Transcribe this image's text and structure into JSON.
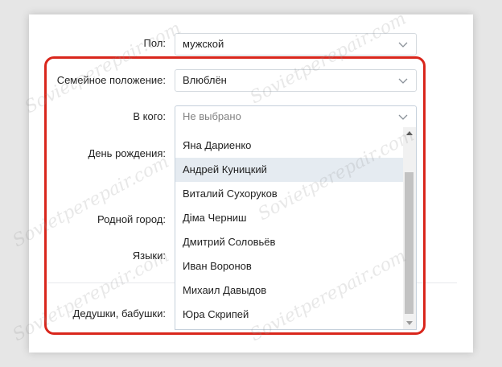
{
  "form": {
    "gender": {
      "label": "Пол:",
      "value": "мужской"
    },
    "marital": {
      "label": "Семейное положение:",
      "value": "Влюблён"
    },
    "partner": {
      "label": "В кого:",
      "placeholder": "Не выбрано"
    },
    "birthday": {
      "label": "День рождения:"
    },
    "hometown": {
      "label": "Родной город:"
    },
    "languages": {
      "label": "Языки:"
    },
    "grandparents": {
      "label": "Дедушки, бабушки:"
    }
  },
  "dropdown": {
    "options": [
      "Яна Дариенко",
      "Андрей Куницкий",
      "Виталий Сухоруков",
      "Діма Черниш",
      "Дмитрий Соловьёв",
      "Иван Воронов",
      "Михаил Давыдов",
      "Юра Скрипей"
    ],
    "highlighted_index": 1
  },
  "watermark": "Sovietperepair.com",
  "colors": {
    "highlight_border": "#d9261c",
    "option_hover": "#e5ebf1",
    "field_border": "#d3d9de"
  }
}
